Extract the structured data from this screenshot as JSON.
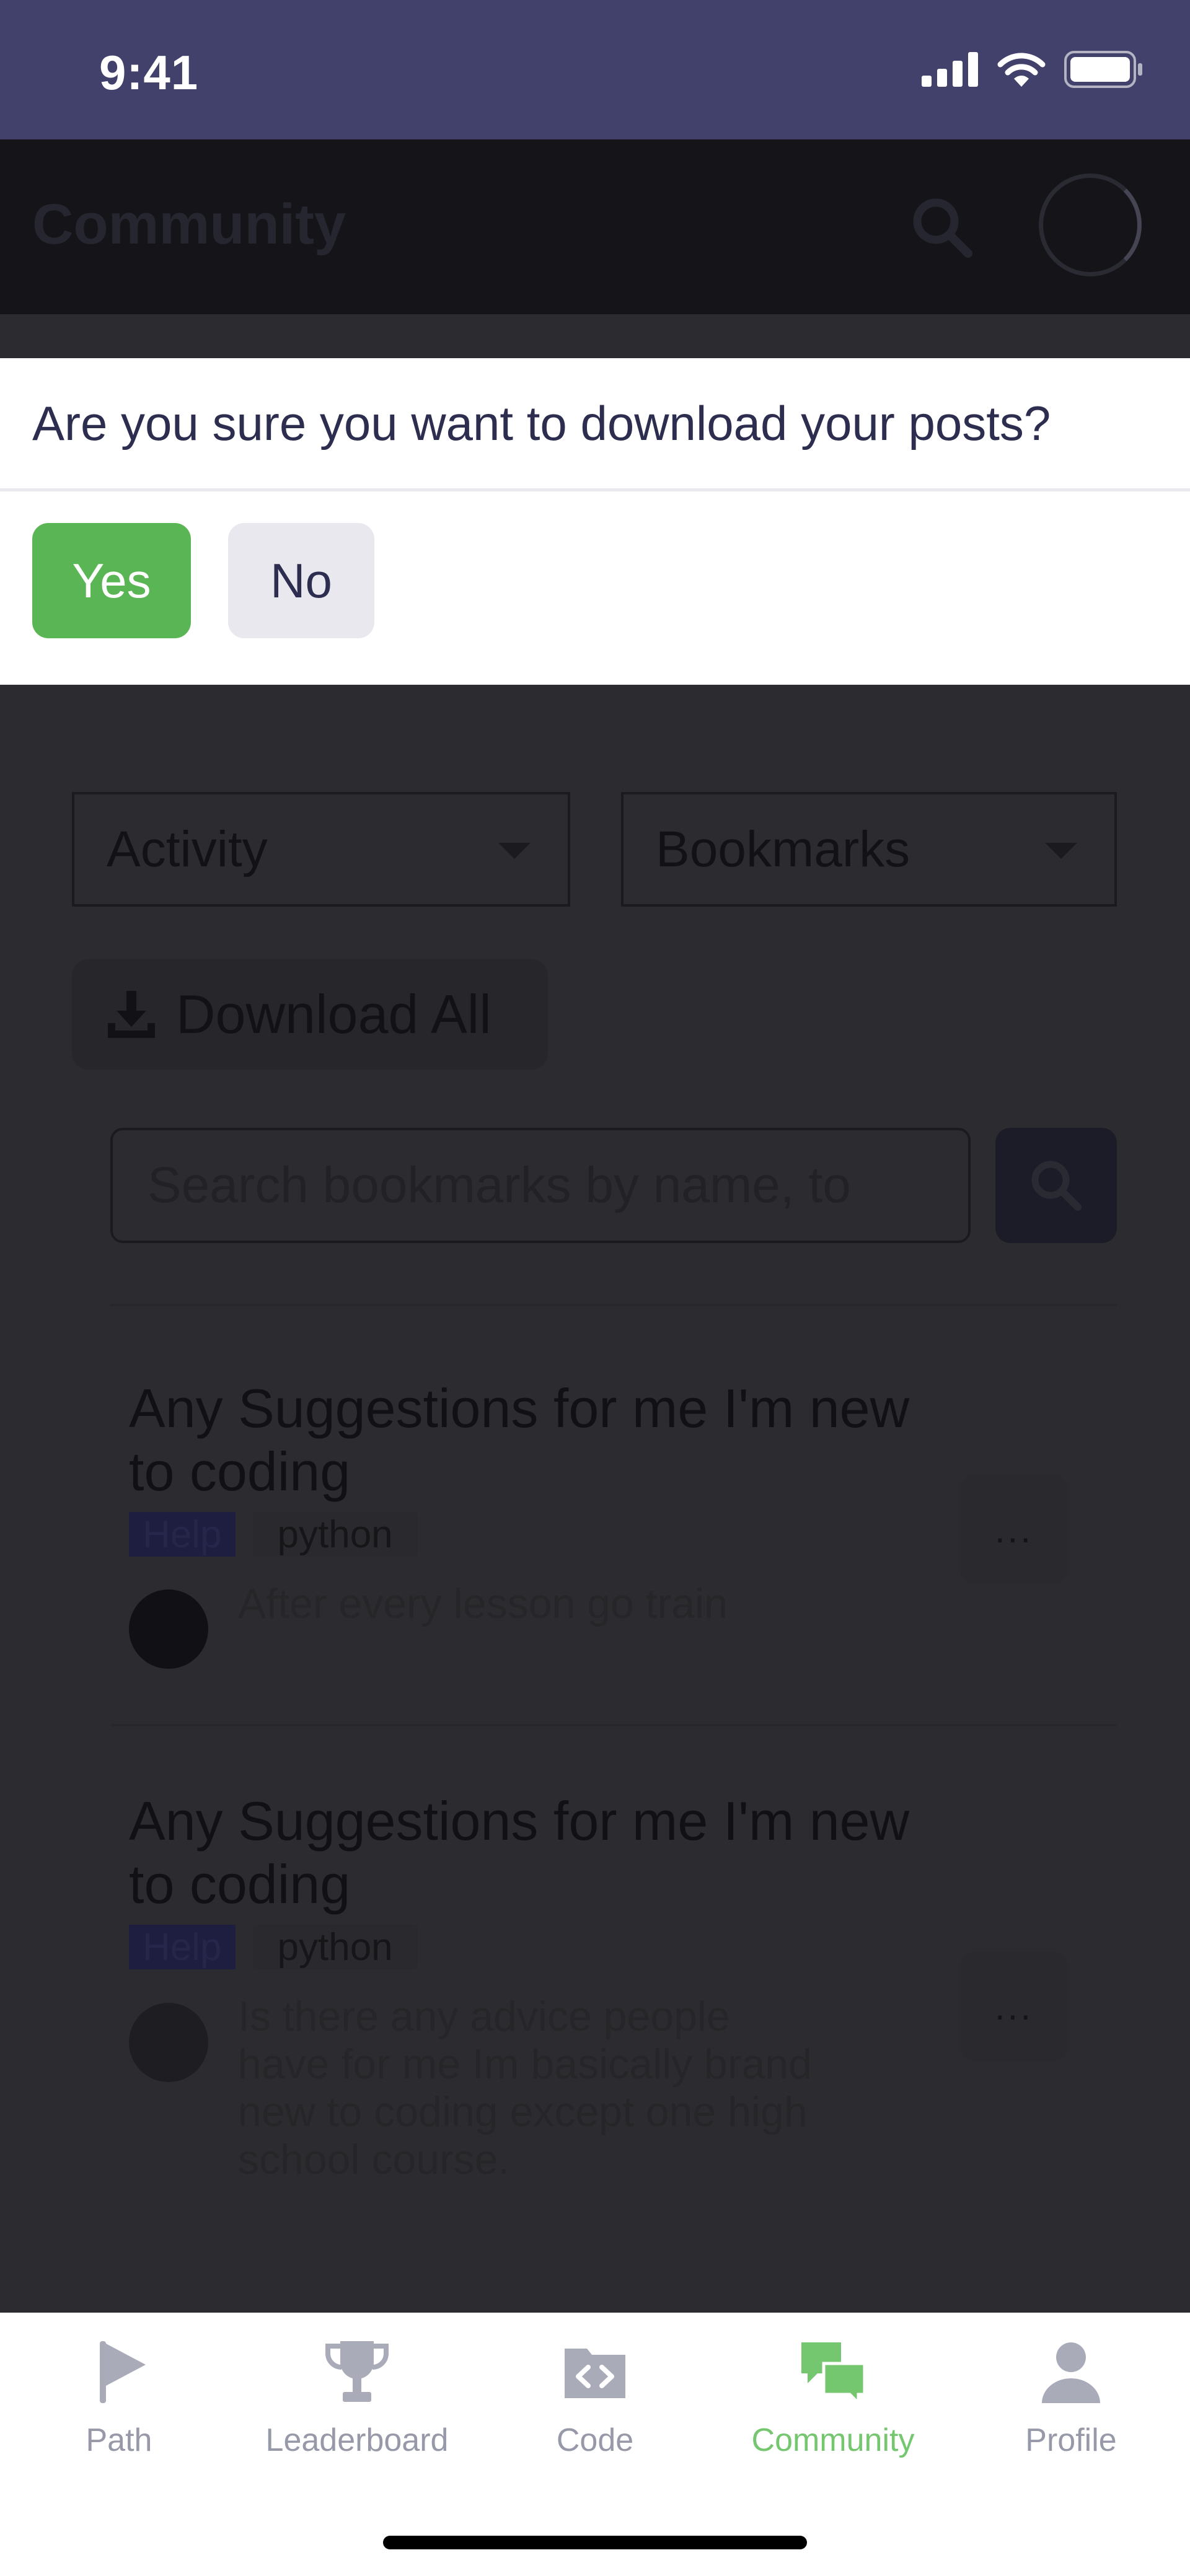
{
  "status_bar": {
    "time": "9:41"
  },
  "header": {
    "title": "Community"
  },
  "confirm": {
    "question": "Are you sure you want to download your posts?",
    "yes_label": "Yes",
    "no_label": "No"
  },
  "filters": {
    "activity_selected": "Activity",
    "bookmarks_selected": "Bookmarks"
  },
  "download_all_label": "Download All",
  "search": {
    "placeholder": "Search bookmarks by name, to"
  },
  "posts": [
    {
      "title": "Any Suggestions for me I'm new to coding",
      "tags": [
        "Help",
        "python"
      ],
      "preview": "After every lesson go train",
      "more": "..."
    },
    {
      "title": "Any Suggestions for me I'm new to coding",
      "tags": [
        "Help",
        "python"
      ],
      "preview": "Is there any advice people have for me Im basically brand new to coding except one high school course.",
      "more": "..."
    }
  ],
  "tabs": [
    {
      "label": "Path",
      "icon": "flag-icon"
    },
    {
      "label": "Leaderboard",
      "icon": "trophy-icon"
    },
    {
      "label": "Code",
      "icon": "code-folder-icon"
    },
    {
      "label": "Community",
      "icon": "chat-bubbles-icon",
      "active": true
    },
    {
      "label": "Profile",
      "icon": "person-icon"
    }
  ],
  "colors": {
    "status_bar": "#41416b",
    "accent_green": "#5ab654",
    "active_tab": "#74c76e",
    "text_dark": "#2c2d4f"
  }
}
